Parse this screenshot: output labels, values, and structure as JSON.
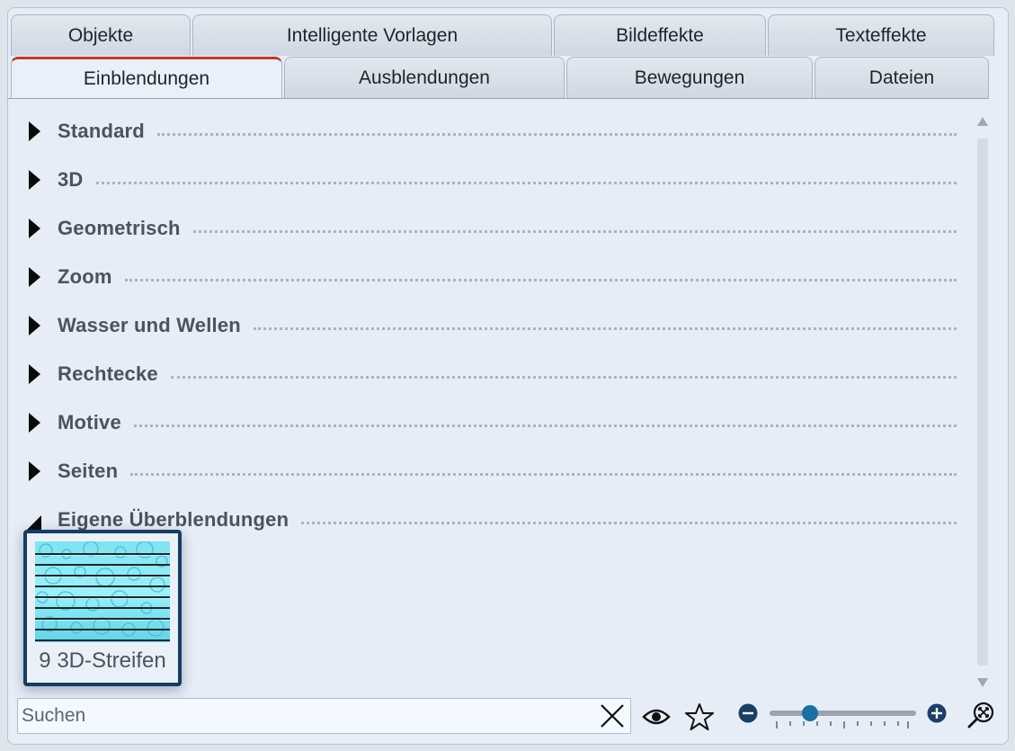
{
  "tabs_row1": [
    {
      "label": "Objekte"
    },
    {
      "label": "Intelligente Vorlagen"
    },
    {
      "label": "Bildeffekte"
    },
    {
      "label": "Texteffekte"
    }
  ],
  "tabs_row2": [
    {
      "label": "Einblendungen",
      "active": true
    },
    {
      "label": "Ausblendungen"
    },
    {
      "label": "Bewegungen"
    },
    {
      "label": "Dateien"
    }
  ],
  "categories": [
    {
      "label": "Standard",
      "expanded": false
    },
    {
      "label": "3D",
      "expanded": false
    },
    {
      "label": "Geometrisch",
      "expanded": false
    },
    {
      "label": "Zoom",
      "expanded": false
    },
    {
      "label": "Wasser und Wellen",
      "expanded": false
    },
    {
      "label": "Rechtecke",
      "expanded": false
    },
    {
      "label": "Motive",
      "expanded": false
    },
    {
      "label": "Seiten",
      "expanded": false
    },
    {
      "label": "Eigene Überblendungen",
      "expanded": true
    }
  ],
  "effect_tile": {
    "label": "9 3D-Streifen",
    "selected": true
  },
  "search": {
    "placeholder": "Suchen",
    "value": ""
  },
  "toolbar": {
    "clear_icon": "close-icon",
    "preview_icon": "eye-icon",
    "favorite_icon": "star-icon",
    "zoom_out_icon": "minus-circle-icon",
    "zoom_in_icon": "plus-circle-icon",
    "zoom_reset_icon": "zoom-fit-icon",
    "zoom_level": 0.25
  },
  "colors": {
    "active_tab_accent": "#c0392b",
    "selection_border": "#153d63",
    "slider_accent": "#1d6fa3"
  }
}
